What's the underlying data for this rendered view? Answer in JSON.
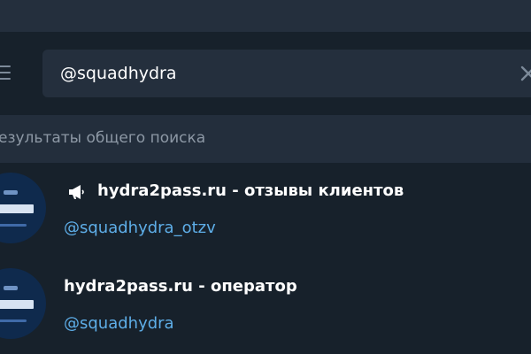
{
  "search": {
    "query": "@squadhydra"
  },
  "section": {
    "title": "езультаты общего поиска"
  },
  "results": [
    {
      "name": "hydra2pass.ru - отзывы клиентов",
      "username": "@squadhydra_otzv",
      "type_icon": "megaphone-icon"
    },
    {
      "name": "hydra2pass.ru - оператор",
      "username": "@squadhydra"
    }
  ],
  "colors": {
    "background": "#17212b",
    "panel": "#242f3d",
    "section_bg": "#232e3c",
    "link": "#5eaee8",
    "muted": "#8d98a5"
  }
}
